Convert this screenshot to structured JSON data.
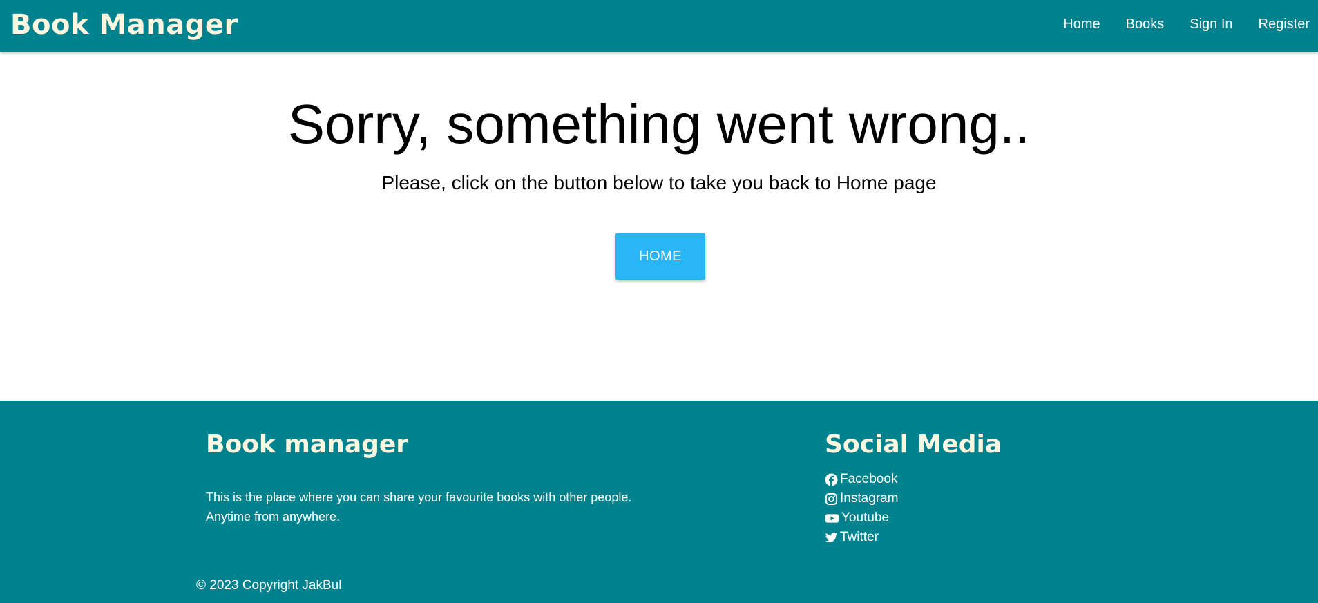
{
  "navbar": {
    "brand": "Book Manager",
    "links": [
      {
        "label": "Home"
      },
      {
        "label": "Books"
      },
      {
        "label": "Sign In"
      },
      {
        "label": "Register"
      }
    ]
  },
  "main": {
    "title": "Sorry, something went wrong..",
    "subtitle": "Please, click on the button below to take you back to Home page",
    "button_label": "HOME"
  },
  "footer": {
    "brand_title": "Book manager",
    "description_lines": [
      "This is the place where you can share your favourite books with other people.",
      "Anytime from anywhere."
    ],
    "social_title": "Social Media",
    "social_links": [
      {
        "label": "Facebook",
        "icon": "facebook-icon"
      },
      {
        "label": "Instagram",
        "icon": "instagram-icon"
      },
      {
        "label": "Youtube",
        "icon": "youtube-icon"
      },
      {
        "label": "Twitter",
        "icon": "twitter-icon"
      }
    ],
    "copyright": "© 2023 Copyright JakBul"
  },
  "colors": {
    "primary": "#00838f",
    "accent_text": "#fff8e1",
    "button": "#29b6f6"
  }
}
